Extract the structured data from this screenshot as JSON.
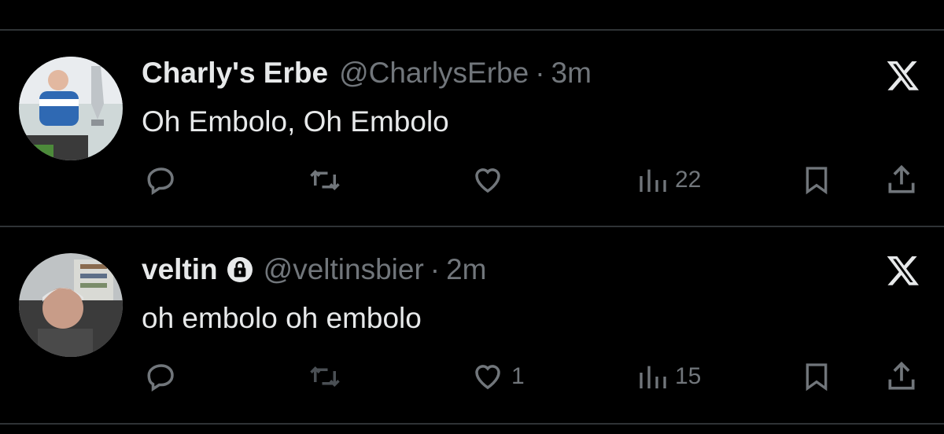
{
  "colors": {
    "background": "#000000",
    "primary_text": "#e7e9ea",
    "secondary_text": "#71767b",
    "divider": "#2f3336"
  },
  "tweets": [
    {
      "display_name": "Charly's Erbe",
      "handle": "@CharlysErbe",
      "separator": "·",
      "time": "3m",
      "text": "Oh Embolo, Oh Embolo",
      "protected": false,
      "avatar_icon": "avatar-photo",
      "actions": {
        "reply": {
          "icon": "reply-icon",
          "count": ""
        },
        "retweet": {
          "icon": "retweet-icon",
          "count": ""
        },
        "like": {
          "icon": "heart-icon",
          "count": ""
        },
        "views": {
          "icon": "views-icon",
          "count": "22"
        },
        "bookmark": {
          "icon": "bookmark-icon"
        },
        "share": {
          "icon": "share-icon"
        }
      }
    },
    {
      "display_name": "veltin",
      "handle": "@veltinsbier",
      "separator": "·",
      "time": "2m",
      "text": "oh embolo oh embolo",
      "protected": true,
      "avatar_icon": "avatar-photo",
      "actions": {
        "reply": {
          "icon": "reply-icon",
          "count": ""
        },
        "retweet": {
          "icon": "retweet-icon",
          "count": ""
        },
        "like": {
          "icon": "heart-icon",
          "count": "1"
        },
        "views": {
          "icon": "views-icon",
          "count": "15"
        },
        "bookmark": {
          "icon": "bookmark-icon"
        },
        "share": {
          "icon": "share-icon"
        }
      }
    }
  ]
}
